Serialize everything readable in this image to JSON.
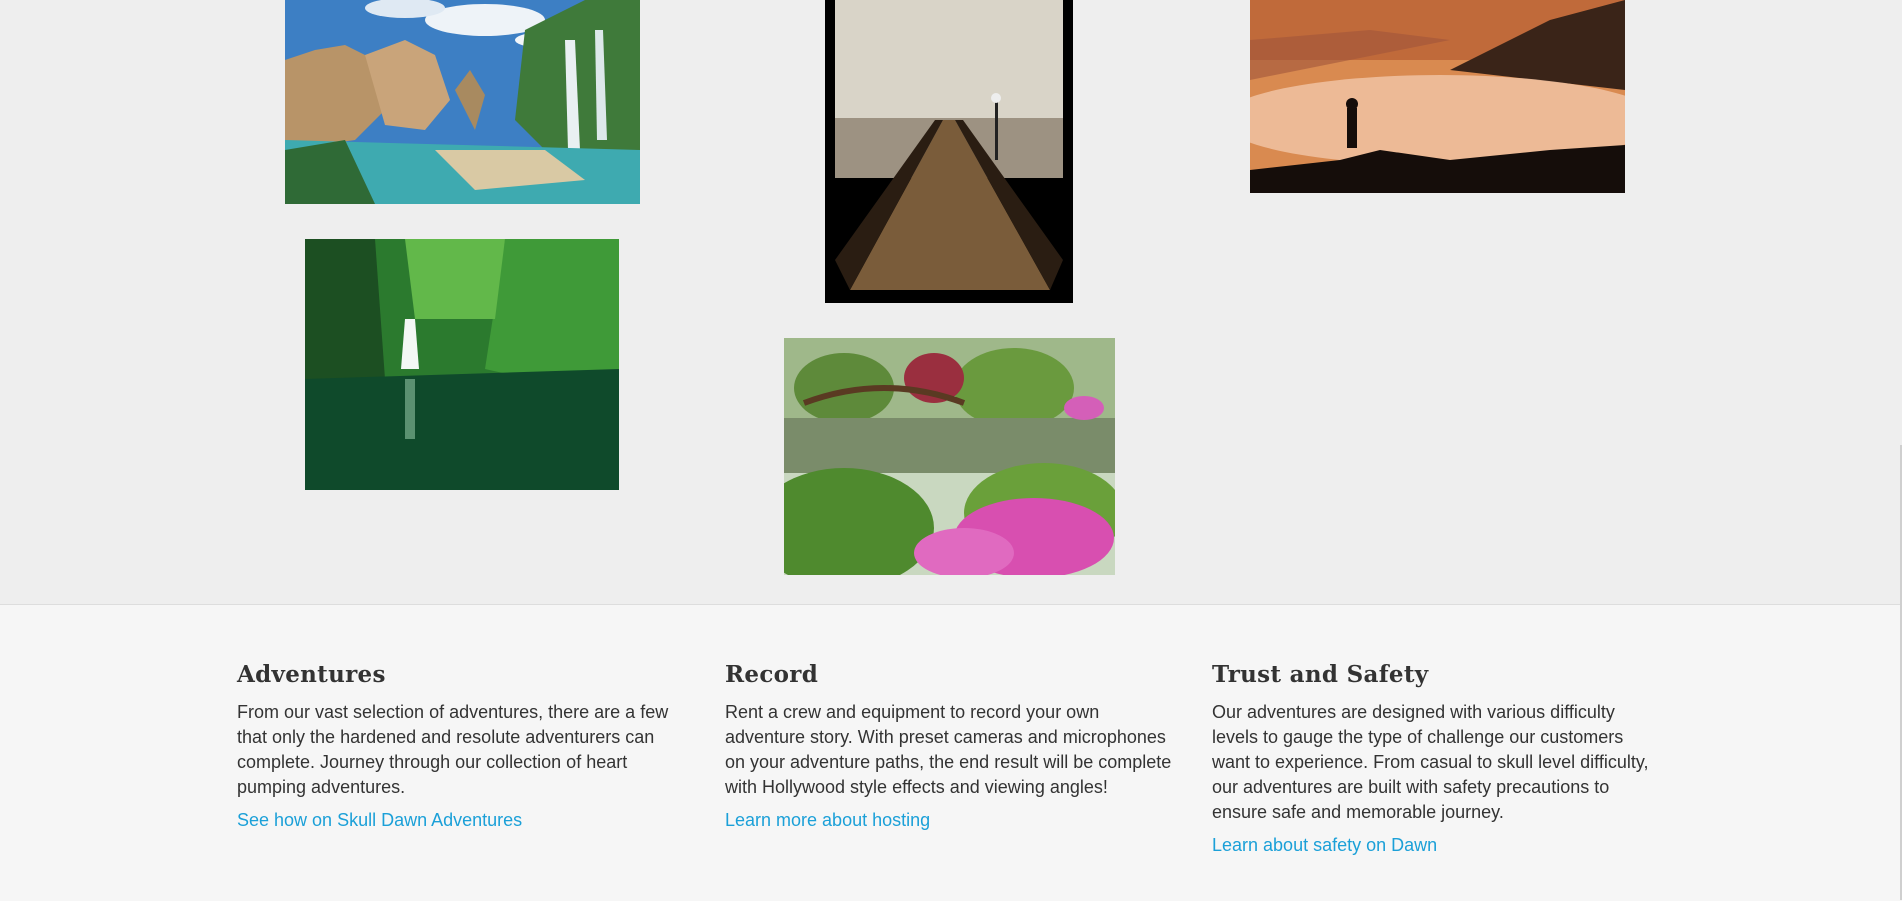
{
  "gallery": {
    "images": [
      {
        "subject": "rock formations and waterfalls by a lagoon"
      },
      {
        "subject": "wooden pier over water"
      },
      {
        "subject": "hiker silhouette above fog at sunset"
      },
      {
        "subject": "green gorge waterfall"
      },
      {
        "subject": "japanese garden bridge with flowers"
      }
    ]
  },
  "features": [
    {
      "title": "Adventures",
      "body": "From our vast selection of adventures, there are a few that only the hardened and resolute adventurers can complete. Journey through our collection of heart pumping adventures.",
      "link": "See how on Skull Dawn Adventures"
    },
    {
      "title": "Record",
      "body": "Rent a crew and equipment to record your own adventure story. With preset cameras and microphones on your adventure paths, the end result will be complete with Hollywood style effects and viewing angles!",
      "link": "Learn more about hosting"
    },
    {
      "title": "Trust and Safety",
      "body": "Our adventures are designed with various difficulty levels to gauge the type of challenge our customers want to experience. From casual to skull level difficulty, our adventures are built with safety precautions to ensure safe and memorable journey.",
      "link": "Learn about safety on Dawn"
    }
  ],
  "colors": {
    "link": "#1ba0d8",
    "text": "#333333",
    "gallery_bg": "#eeeeee",
    "footer_bg": "#f6f6f6"
  }
}
